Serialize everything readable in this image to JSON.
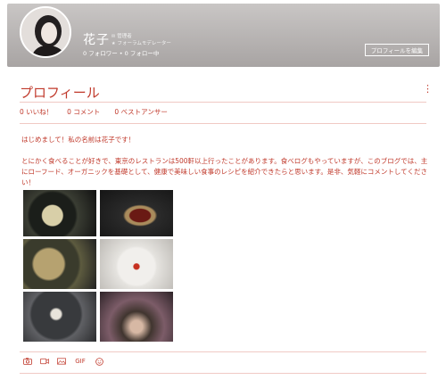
{
  "header": {
    "name": "花子",
    "role_admin": "管理者",
    "role_moderator": "フォーラムモデレーター",
    "followers": "0 フォロワー • 0 フォロー中",
    "edit_button": "プロフィールを編集"
  },
  "profile": {
    "title": "プロフィール",
    "stats": [
      "0 いいね！",
      "0 コメント",
      "0 ベストアンサー"
    ],
    "intro": "はじめまして！私の名前は花子です！",
    "body": "とにかく食べることが好きで、東京のレストランは500軒以上行ったことがあります。食べログもやっていますが、このブログでは、主にローフード、オーガニックを基礎として、健康で美味しい食事のレシピを紹介できたらと思います。是非、気軽にコメントしてください！"
  },
  "toolbar": {
    "icons": [
      "camera-icon",
      "video-icon",
      "gallery-icon",
      "gif-icon",
      "emoji-icon"
    ],
    "gif_label": "GIF"
  },
  "colors": {
    "accent": "#c0392b",
    "header_bg": "#b4b0af"
  }
}
